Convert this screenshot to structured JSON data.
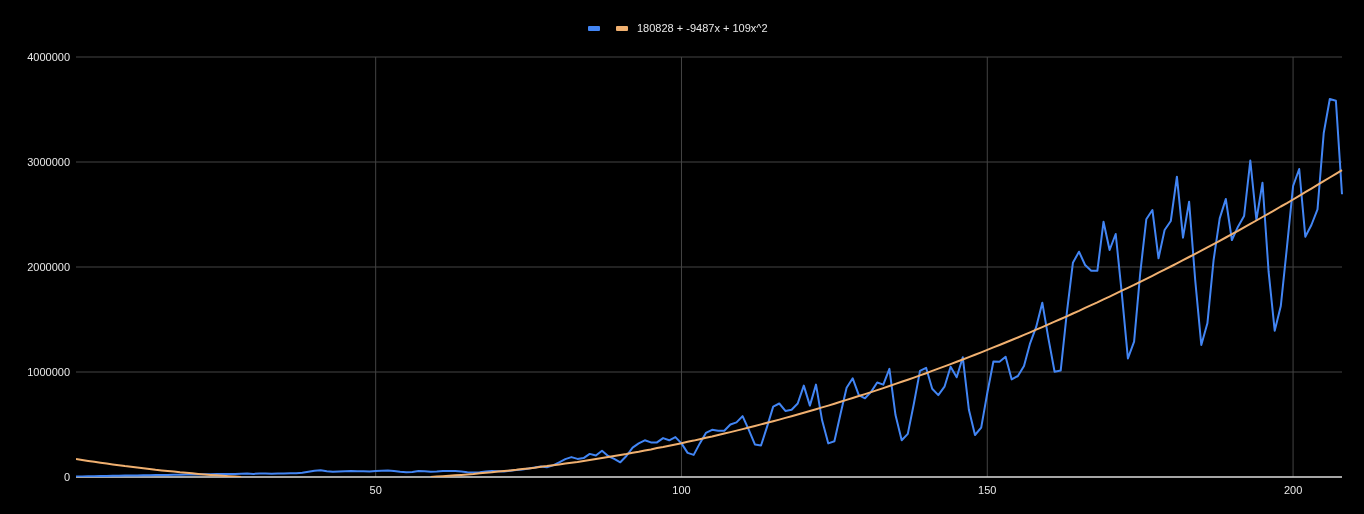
{
  "chart": {
    "chart_data": {
      "type": "line",
      "x": [
        1,
        2,
        3,
        4,
        5,
        6,
        7,
        8,
        9,
        10,
        11,
        12,
        13,
        14,
        15,
        16,
        17,
        18,
        19,
        20,
        21,
        22,
        23,
        24,
        25,
        26,
        27,
        28,
        29,
        30,
        31,
        32,
        33,
        34,
        35,
        36,
        37,
        38,
        39,
        40,
        41,
        42,
        43,
        44,
        45,
        46,
        47,
        48,
        49,
        50,
        51,
        52,
        53,
        54,
        55,
        56,
        57,
        58,
        59,
        60,
        61,
        62,
        63,
        64,
        65,
        66,
        67,
        68,
        69,
        70,
        71,
        72,
        73,
        74,
        75,
        76,
        77,
        78,
        79,
        80,
        81,
        82,
        83,
        84,
        85,
        86,
        87,
        88,
        89,
        90,
        91,
        92,
        93,
        94,
        95,
        96,
        97,
        98,
        99,
        100,
        101,
        102,
        103,
        104,
        105,
        106,
        107,
        108,
        109,
        110,
        111,
        112,
        113,
        114,
        115,
        116,
        117,
        118,
        119,
        120,
        121,
        122,
        123,
        124,
        125,
        126,
        127,
        128,
        129,
        130,
        131,
        132,
        133,
        134,
        135,
        136,
        137,
        138,
        139,
        140,
        141,
        142,
        143,
        144,
        145,
        146,
        147,
        148,
        149,
        150,
        151,
        152,
        153,
        154,
        155,
        156,
        157,
        158,
        159,
        160,
        161,
        162,
        163,
        164,
        165,
        166,
        167,
        168,
        169,
        170,
        171,
        172,
        173,
        174,
        175,
        176,
        177,
        178,
        179,
        180,
        181,
        182,
        183,
        184,
        185,
        186,
        187,
        188,
        189,
        190,
        191,
        192,
        193,
        194,
        195,
        196,
        197,
        198,
        199,
        200,
        201,
        202,
        203,
        204,
        205,
        206,
        207,
        208
      ],
      "series": [
        {
          "color": "#4285f4",
          "values": [
            5000,
            6000,
            7000,
            8000,
            9000,
            10000,
            11000,
            12000,
            13000,
            14000,
            15000,
            16000,
            17000,
            18000,
            19000,
            20000,
            21000,
            22000,
            23000,
            24000,
            25000,
            26000,
            27000,
            28000,
            29000,
            30000,
            30000,
            31000,
            32000,
            30000,
            33000,
            32000,
            31000,
            33000,
            34000,
            35000,
            36000,
            40000,
            50000,
            60000,
            65000,
            55000,
            50000,
            52000,
            55000,
            58000,
            55000,
            54000,
            53000,
            58000,
            60000,
            62000,
            58000,
            50000,
            45000,
            48000,
            58000,
            55000,
            50000,
            52000,
            58000,
            56000,
            58000,
            52000,
            46000,
            42000,
            45000,
            52000,
            56000,
            55000,
            52000,
            60000,
            66000,
            72000,
            80000,
            90000,
            100000,
            92000,
            110000,
            140000,
            170000,
            190000,
            172000,
            180000,
            220000,
            205000,
            250000,
            200000,
            172000,
            140000,
            200000,
            280000,
            320000,
            350000,
            330000,
            330000,
            370000,
            350000,
            380000,
            320000,
            230000,
            210000,
            320000,
            420000,
            450000,
            440000,
            440000,
            500000,
            520000,
            580000,
            450000,
            310000,
            300000,
            480000,
            670000,
            700000,
            630000,
            640000,
            700000,
            870000,
            680000,
            880000,
            540000,
            320000,
            340000,
            600000,
            850000,
            940000,
            780000,
            750000,
            810000,
            900000,
            880000,
            1030000,
            590000,
            350000,
            410000,
            700000,
            1010000,
            1040000,
            840000,
            780000,
            860000,
            1050000,
            950000,
            1140000,
            640000,
            400000,
            470000,
            800000,
            1100000,
            1098000,
            1146000,
            930000,
            962000,
            1057000,
            1273000,
            1430000,
            1660000,
            1320000,
            1003000,
            1013000,
            1560000,
            2040000,
            2146000,
            2019000,
            1965000,
            1965000,
            2430000,
            2162000,
            2314000,
            1749000,
            1130000,
            1289000,
            1940000,
            2454000,
            2543000,
            2083000,
            2352000,
            2438000,
            2860000,
            2279000,
            2622000,
            1876000,
            1257000,
            1464000,
            2067000,
            2463000,
            2648000,
            2257000,
            2384000,
            2486000,
            3013000,
            2448000,
            2803000,
            1955000,
            1393000,
            1629000,
            2194000,
            2771000,
            2933000,
            2289000,
            2400000,
            2549000,
            3273000,
            3600000,
            3584000,
            2692000
          ]
        },
        {
          "name": "180828 + -9487x + 109x^2",
          "color": "#f0b070",
          "values": [
            171000,
            162000,
            153000,
            145000,
            136000,
            128000,
            120000,
            112000,
            104000,
            97000,
            90000,
            83000,
            76000,
            69000,
            63000,
            57000,
            51000,
            45000,
            40000,
            35000,
            30000,
            25000,
            20000,
            16000,
            12000,
            8000,
            4000,
            1000,
            null,
            null,
            null,
            null,
            null,
            null,
            null,
            null,
            null,
            null,
            null,
            null,
            null,
            null,
            null,
            null,
            null,
            null,
            null,
            null,
            null,
            null,
            null,
            null,
            null,
            null,
            null,
            null,
            null,
            null,
            1000,
            4000,
            8000,
            12000,
            16000,
            20000,
            25000,
            29000,
            35000,
            40000,
            45000,
            51000,
            57000,
            63000,
            69000,
            76000,
            82000,
            89000,
            97000,
            104000,
            112000,
            119000,
            128000,
            136000,
            144000,
            153000,
            162000,
            171000,
            180000,
            190000,
            200000,
            210000,
            220000,
            231000,
            241000,
            252000,
            263000,
            275000,
            286000,
            298000,
            310000,
            322000,
            335000,
            347000,
            360000,
            373000,
            386000,
            400000,
            414000,
            428000,
            442000,
            456000,
            471000,
            486000,
            501000,
            516000,
            531000,
            547000,
            563000,
            579000,
            595000,
            612000,
            629000,
            646000,
            663000,
            680000,
            698000,
            716000,
            734000,
            752000,
            771000,
            790000,
            809000,
            828000,
            847000,
            867000,
            887000,
            907000,
            927000,
            947000,
            968000,
            989000,
            1010000,
            1032000,
            1053000,
            1075000,
            1097000,
            1119000,
            1142000,
            1164000,
            1187000,
            1210000,
            1234000,
            1257000,
            1281000,
            1305000,
            1329000,
            1353000,
            1378000,
            1403000,
            1428000,
            1453000,
            1479000,
            1505000,
            1530000,
            1557000,
            1583000,
            1610000,
            1636000,
            1663000,
            1691000,
            1718000,
            1746000,
            1774000,
            1802000,
            1830000,
            1859000,
            1888000,
            1916000,
            1946000,
            1975000,
            2005000,
            2035000,
            2065000,
            2095000,
            2126000,
            2156000,
            2187000,
            2218000,
            2250000,
            2281000,
            2313000,
            2345000,
            2378000,
            2410000,
            2443000,
            2476000,
            2509000,
            2542000,
            2576000,
            2609000,
            2643000,
            2678000,
            2712000,
            2747000,
            2782000,
            2817000,
            2852000,
            2888000,
            2923000
          ]
        }
      ],
      "xlim": [
        1,
        208
      ],
      "ylim": [
        0,
        4000000
      ],
      "xticks": [
        50,
        100,
        150,
        200
      ],
      "yticks": [
        0,
        1000000,
        2000000,
        3000000,
        4000000
      ],
      "grid": true
    }
  }
}
